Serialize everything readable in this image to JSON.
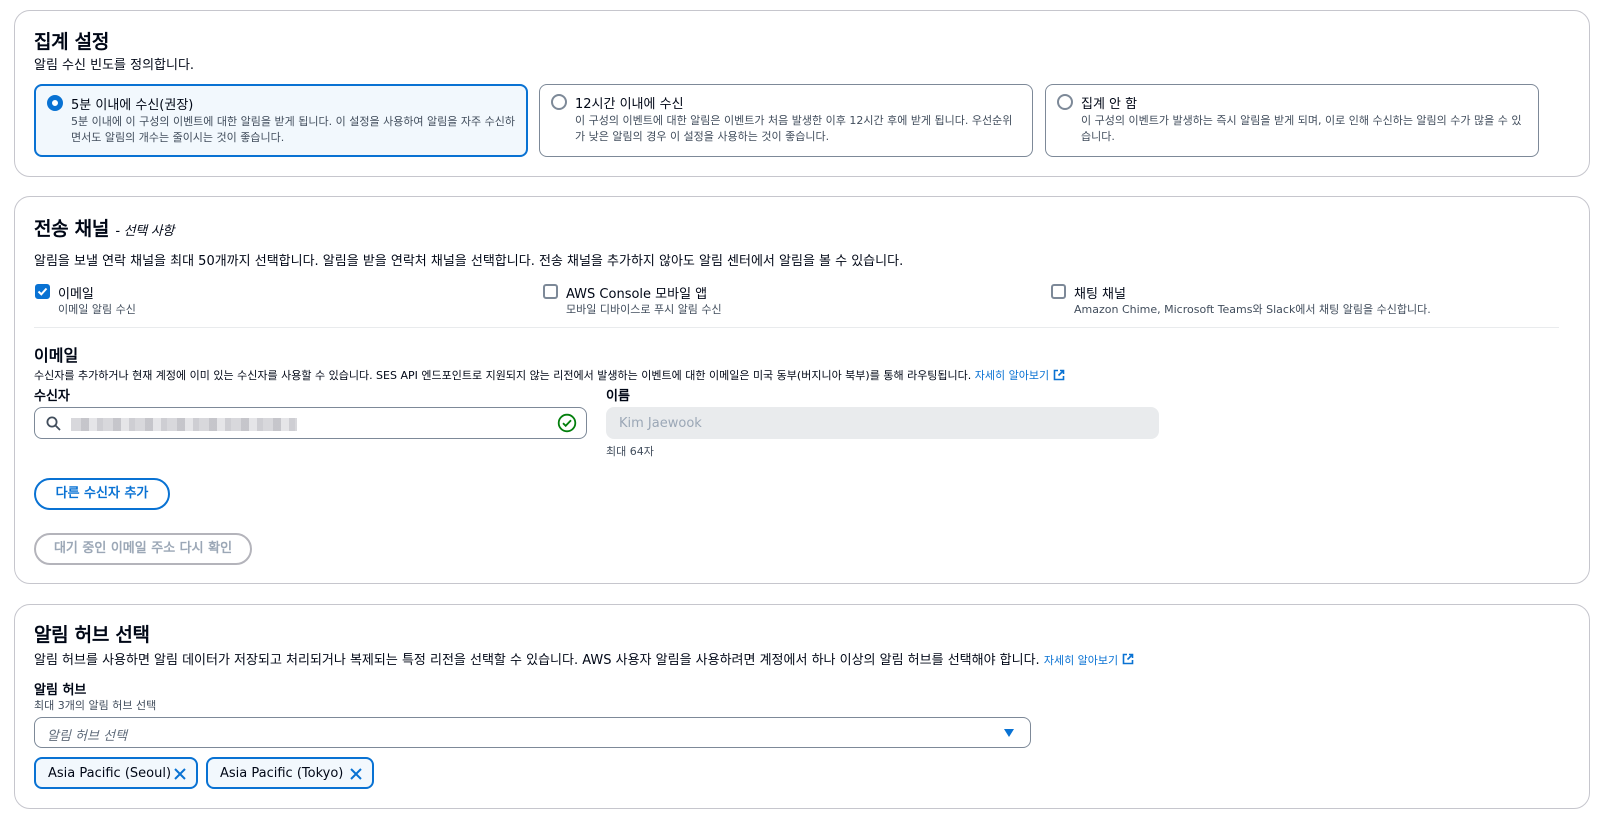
{
  "aggregation": {
    "title": "집계 설정",
    "description": "알림 수신 빈도를 정의합니다.",
    "options": [
      {
        "label": "5분 이내에 수신(권장)",
        "description": "5분 이내에 이 구성의 이벤트에 대한 알림을 받게 됩니다. 이 설정을 사용하여 알림을 자주 수신하면서도 알림의 개수는 줄이시는 것이 좋습니다.",
        "selected": true
      },
      {
        "label": "12시간 이내에 수신",
        "description": "이 구성의 이벤트에 대한 알림은 이벤트가 처음 발생한 이후 12시간 후에 받게 됩니다. 우선순위가 낮은 알림의 경우 이 설정을 사용하는 것이 좋습니다.",
        "selected": false
      },
      {
        "label": "집계 안 함",
        "description": "이 구성의 이벤트가 발생하는 즉시 알림을 받게 되며, 이로 인해 수신하는 알림의 수가 많을 수 있습니다.",
        "selected": false
      }
    ]
  },
  "channels": {
    "title": "전송 채널",
    "optional": "- 선택 사항",
    "description": "알림을 보낼 연락 채널을 최대 50개까지 선택합니다. 알림을 받을 연락처 채널을 선택합니다. 전송 채널을 추가하지 않아도 알림 센터에서 알림을 볼 수 있습니다.",
    "items": [
      {
        "label": "이메일",
        "sub": "이메일 알림 수신",
        "checked": true
      },
      {
        "label": "AWS Console 모바일 앱",
        "sub": "모바일 디바이스로 푸시 알림 수신",
        "checked": false
      },
      {
        "label": "채팅 채널",
        "sub": "Amazon Chime, Microsoft Teams와 Slack에서 채팅 알림을 수신합니다.",
        "checked": false
      }
    ]
  },
  "email": {
    "title": "이메일",
    "description": "수신자를 추가하거나 현재 계정에 이미 있는 수신자를 사용할 수 있습니다. SES API 엔드포인트로 지원되지 않는 리전에서 발생하는 이벤트에 대한 이메일은 미국 동부(버지니아 북부)를 통해 라우팅됩니다.",
    "learn_more": "자세히 알아보기",
    "recipient_label": "수신자",
    "name_label": "이름",
    "name_placeholder": "Kim Jaewook",
    "name_hint": "최대 64자",
    "add_recipient": "다른 수신자 추가",
    "resend": "대기 중인 이메일 주소 다시 확인"
  },
  "hub": {
    "title": "알림 허브 선택",
    "description": "알림 허브를 사용하면 알림 데이터가 저장되고 처리되거나 복제되는 특정 리전을 선택할 수 있습니다. AWS 사용자 알림을 사용하려면 계정에서 하나 이상의 알림 허브를 선택해야 합니다.",
    "learn_more": "자세히 알아보기",
    "label": "알림 허브",
    "hint": "최대 3개의 알림 허브 선택",
    "placeholder": "알림 허브 선택",
    "tokens": [
      "Asia Pacific (Seoul)",
      "Asia Pacific (Tokyo)"
    ]
  },
  "colors": {
    "accent": "#0972d3",
    "border": "#7d8998",
    "success": "#037f0c"
  }
}
